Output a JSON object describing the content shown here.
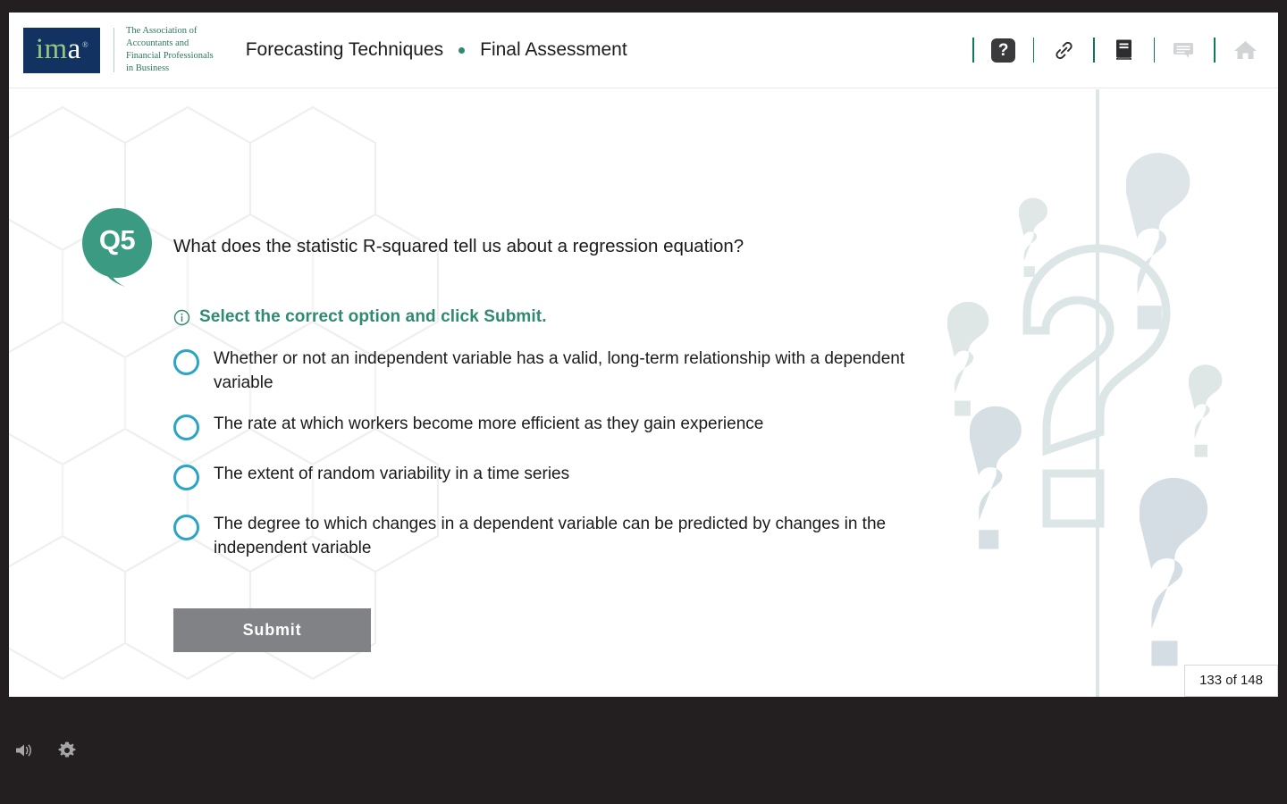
{
  "brand": {
    "logo_wordmark": "ima",
    "logo_registered": "®",
    "tagline": "The Association of\nAccountants and\nFinancial Professionals\nin Business",
    "navy": "#123261",
    "green": "#2f8a72",
    "light_green": "#95c77f",
    "radio_cyan": "#2ba4c6",
    "submit_gray": "#808285"
  },
  "header": {
    "course_title": "Forecasting Techniques",
    "separator_dot": "•",
    "section_title": "Final Assessment",
    "icons": [
      {
        "name": "help-icon",
        "glyph": "?",
        "state": "active"
      },
      {
        "name": "link-icon",
        "glyph": "link",
        "state": "active"
      },
      {
        "name": "book-icon",
        "glyph": "book",
        "state": "active"
      },
      {
        "name": "comment-icon",
        "glyph": "speech-bubble",
        "state": "disabled"
      },
      {
        "name": "home-icon",
        "glyph": "home",
        "state": "disabled"
      }
    ]
  },
  "question": {
    "number_label": "Q5",
    "prompt": "What does the statistic R-squared tell us about a regression equation?",
    "instruction_icon": "info-circle-icon",
    "instruction": "Select the correct option and click Submit.",
    "options": [
      {
        "id": "option-a",
        "text": "Whether or not an independent variable has a valid, long-term relationship with a dependent variable",
        "selected": false
      },
      {
        "id": "option-b",
        "text": "The rate at which workers become more efficient as they gain experience",
        "selected": false
      },
      {
        "id": "option-c",
        "text": "The extent of random variability in a time series",
        "selected": false
      },
      {
        "id": "option-d",
        "text": "The degree to which changes in a dependent variable can be predicted by changes in the independent variable",
        "selected": false
      }
    ],
    "submit_label": "Submit"
  },
  "footer": {
    "page_counter": "133 of 148",
    "controls": [
      {
        "name": "volume-icon",
        "label": "Volume"
      },
      {
        "name": "settings-gear-icon",
        "label": "Settings"
      }
    ]
  }
}
